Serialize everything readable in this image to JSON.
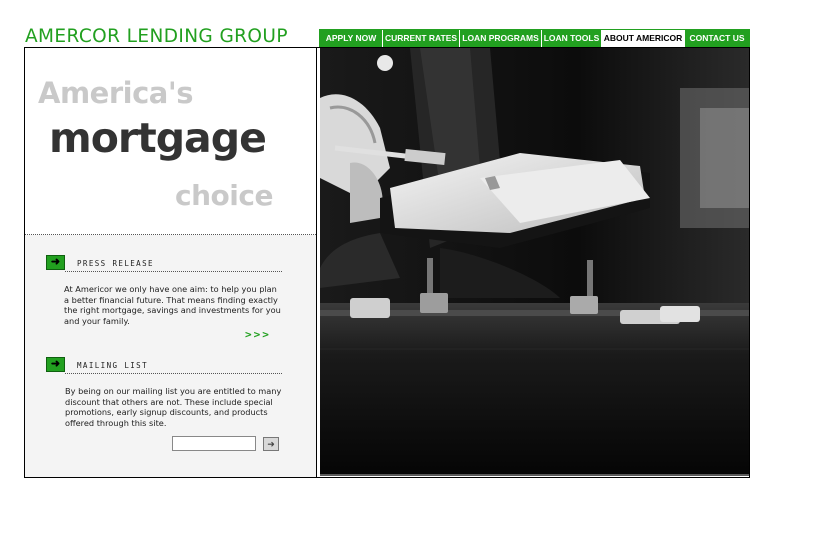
{
  "brand": {
    "name": "AMERCOR LENDING GROUP"
  },
  "nav": {
    "items": [
      {
        "label": "APPLY NOW"
      },
      {
        "label": "CURRENT RATES"
      },
      {
        "label": "LOAN PROGRAMS"
      },
      {
        "label": "LOAN TOOLS"
      },
      {
        "label": "ABOUT AMERICOR"
      },
      {
        "label": "CONTACT US"
      }
    ],
    "active": "ABOUT AMERICOR"
  },
  "hero": {
    "line1": "America's",
    "line2": "mortgage",
    "line3": "choice"
  },
  "press_release": {
    "title": "PRESS RELEASE",
    "text": "At Americor we only have one aim: to help you plan a better financial future. That means finding exactly the right mortgage, savings and investments for you and your family.",
    "more_label": ">>>"
  },
  "mailing_list": {
    "title": "MAILING LIST",
    "text": "By being on our mailing list you are entitled to many discount that others are not. These include special promotions, early signup discounts, and products offered through this site.",
    "input_value": ""
  },
  "colors": {
    "brand_green": "#22a020",
    "hero_gray": "#c9c9c9",
    "hero_dark": "#333333"
  },
  "icons": {
    "section_arrow": "arrow-right-icon",
    "submit": "arrow-right-icon"
  }
}
